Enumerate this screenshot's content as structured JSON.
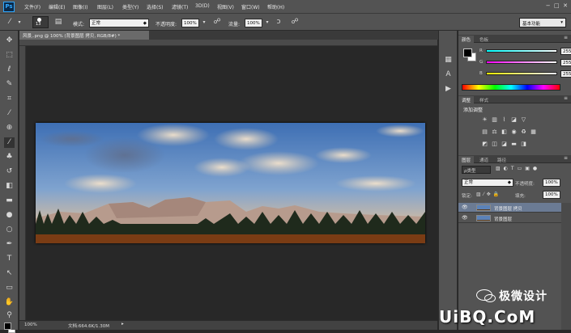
{
  "app": {
    "logo": "Ps",
    "window_controls": [
      "−",
      "□",
      "✕"
    ]
  },
  "menu": [
    "文件(F)",
    "编辑(E)",
    "图像(I)",
    "图层(L)",
    "类型(Y)",
    "选择(S)",
    "滤镜(T)",
    "3D(D)",
    "视图(V)",
    "窗口(W)",
    "帮助(H)"
  ],
  "options": {
    "brush_size": "13",
    "mode_label": "模式:",
    "mode_value": "正常",
    "opacity_label": "不透明度:",
    "opacity_value": "100%",
    "flow_label": "流量:",
    "flow_value": "100%",
    "workspace": "基本功能"
  },
  "document": {
    "tab_title": "风景,.png @ 100% (背景图层 拷贝, RGB/8#) *",
    "zoom": "100%",
    "doc_info": "文档:664.6K/1.30M"
  },
  "colors": {
    "tabs": [
      "颜色",
      "色板"
    ],
    "channels": [
      {
        "label": "R",
        "value": "255",
        "gradient": "#00ffff"
      },
      {
        "label": "G",
        "value": "255",
        "gradient": "#ff00ff"
      },
      {
        "label": "B",
        "value": "255",
        "gradient": "#ffff00"
      }
    ]
  },
  "adjustments": {
    "tabs": [
      "调整",
      "样式"
    ],
    "title": "添加调整"
  },
  "layers": {
    "tabs": [
      "图层",
      "通道",
      "路径"
    ],
    "filter_label": "ρ类型",
    "blend_mode": "正常",
    "opacity_label": "不透明度:",
    "opacity_value": "100%",
    "lock_label": "锁定:",
    "fill_label": "填充:",
    "fill_value": "100%",
    "items": [
      {
        "name": "背景图层 拷贝",
        "selected": true
      },
      {
        "name": "背景图层",
        "selected": false
      }
    ]
  },
  "watermark": {
    "brand": "极微设计",
    "site": "UiBQ.CoM"
  }
}
